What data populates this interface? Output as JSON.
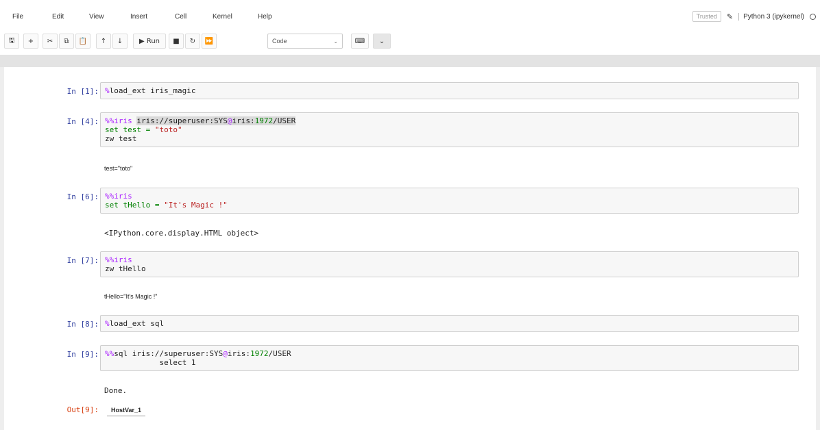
{
  "menu": [
    "File",
    "Edit",
    "View",
    "Insert",
    "Cell",
    "Kernel",
    "Help"
  ],
  "kernel": {
    "trusted": "Trusted",
    "name": "Python 3 (ipykernel)"
  },
  "toolbar": {
    "run_label": "Run",
    "cell_type": "Code"
  },
  "cells": [
    {
      "prompt": "In [1]:",
      "line1_magic": "%",
      "line1_rest": "load_ext iris_magic"
    },
    {
      "prompt": "In [4]:",
      "magic": "%%",
      "kw": "iris ",
      "conn_a": "iris://superuser:SYS",
      "at": "@",
      "conn_b": "iris:",
      "port": "1972",
      "conn_c": "/USER",
      "line2_a": "set test = ",
      "line2_str": "\"toto\"",
      "line3": "zw test",
      "output": "test=\"toto\""
    },
    {
      "prompt": "In [6]:",
      "magic": "%%",
      "kw": "iris",
      "line2_a": "set tHello = ",
      "line2_str": "\"It's Magic !\"",
      "output": "<IPython.core.display.HTML object>"
    },
    {
      "prompt": "In [7]:",
      "magic": "%%",
      "kw": "iris",
      "line2": "zw tHello",
      "output": "tHello=\"It's Magic !\""
    },
    {
      "prompt": "In [8]:",
      "line1_magic": "%",
      "line1_rest": "load_ext sql"
    },
    {
      "prompt": "In [9]:",
      "magic": "%%",
      "kw": "sql iris://superuser:SYS",
      "at": "@",
      "conn_b": "iris:",
      "port": "1972",
      "conn_c": "/USER",
      "line2": "            select 1",
      "output": "Done."
    },
    {
      "prompt": "Out[9]:",
      "table_header": "HostVar_1"
    }
  ],
  "colors": {
    "prompt_in": "#303F9F",
    "prompt_out": "#D84315",
    "magic": "#AA22FF",
    "string": "#BA2121",
    "number": "#008000"
  }
}
